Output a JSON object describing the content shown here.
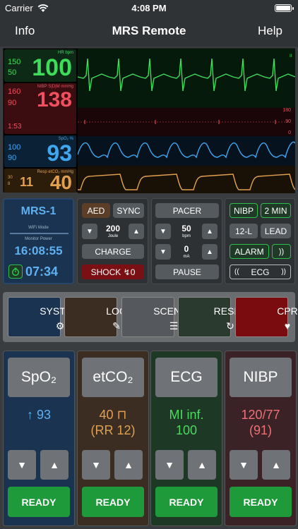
{
  "status": {
    "carrier": "Carrier",
    "time": "4:08 PM"
  },
  "nav": {
    "left": "Info",
    "title": "MRS Remote",
    "right": "Help"
  },
  "monitor": {
    "hr": {
      "label": "HR  bpm",
      "value": "100",
      "hi": "150",
      "lo": "50",
      "color": "#3ddc5a"
    },
    "nibp": {
      "label": "NIBP S|D|M  mmHg",
      "value": "138",
      "hi": "160",
      "lo": "90",
      "time": "1:53",
      "color": "#f05060"
    },
    "spo2": {
      "label": "SpO₂  %",
      "value": "93",
      "hi": "100",
      "lo": "90",
      "color": "#3fa7f0"
    },
    "co2": {
      "label": "Resp       etCO₂ mmHg",
      "resp": "11",
      "value": "40",
      "hi": "30",
      "lo": "8",
      "color": "#e0a050"
    },
    "scale": {
      "top": "180",
      "mid": "90",
      "bot": "0"
    }
  },
  "device": {
    "name": "MRS-1",
    "wifi_mode": "WiFi Mode",
    "monitor_power": "Monitor Power",
    "clock": "16:08:55",
    "timer": "07:34"
  },
  "defib": {
    "aed": "AED",
    "sync": "SYNC",
    "energy": "200",
    "energy_unit": "Joule",
    "charge": "CHARGE",
    "shock": "SHOCK ↯0"
  },
  "pacer": {
    "pacer": "PACER",
    "rate": "50",
    "rate_unit": "bpm",
    "current": "0",
    "current_unit": "mA",
    "pause": "PAUSE"
  },
  "misc": {
    "nibp": "NIBP",
    "interval": "2 MIN",
    "twelve_lead": "12-L",
    "lead": "LEAD",
    "alarm": "ALARM",
    "ecg": "ECG"
  },
  "modes": [
    {
      "label": "SYSTEM",
      "icon": "⚙"
    },
    {
      "label": "LOG",
      "icon": "✎"
    },
    {
      "label": "SCENES",
      "icon": "☰"
    },
    {
      "label": "RESET",
      "icon": "↻"
    },
    {
      "label": "CPR",
      "icon": "♥"
    }
  ],
  "params": [
    {
      "name": "SpO₂",
      "line1": "↑ 93",
      "line2": "",
      "color": "#5fb0f0"
    },
    {
      "name": "etCO₂",
      "line1": "40 ⊓",
      "line2": "(RR 12)",
      "color": "#e0a050"
    },
    {
      "name": "ECG",
      "line1": "MI inf.",
      "line2": "100",
      "color": "#4ed860"
    },
    {
      "name": "NIBP",
      "line1": "120/77",
      "line2": "(91)",
      "color": "#f07078"
    }
  ],
  "ready_label": "READY"
}
